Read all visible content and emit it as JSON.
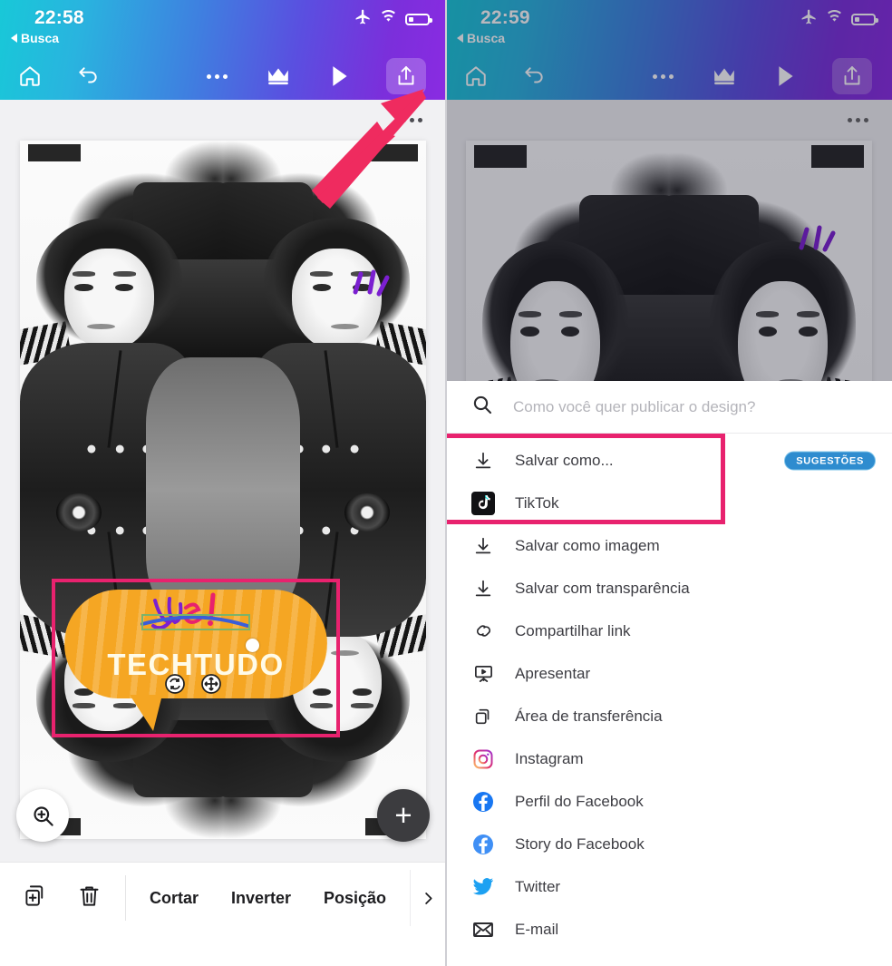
{
  "colors": {
    "accent_pink": "#e8226e",
    "badge_blue": "#2e8ccf",
    "sticker_yellow": "#f5a623",
    "gradient_start": "#18c8d8",
    "gradient_end": "#8a2be2",
    "fab_dark": "#3c3c3f"
  },
  "left_panel": {
    "status": {
      "time": "22:58",
      "back_label": "Busca",
      "icons": [
        "airplane-mode-icon",
        "wifi-icon",
        "battery-icon"
      ]
    },
    "toolbar": {
      "home_icon": "home-icon",
      "undo_icon": "undo-icon",
      "more_icon": "more-dots-icon",
      "crown_icon": "crown-icon",
      "play_icon": "play-icon",
      "share_icon": "share-upload-icon"
    },
    "canvas": {
      "overflow_icon": "more-dots-icon",
      "zoom_icon": "zoom-in-icon",
      "add_label": "+",
      "sticker": {
        "script_text": "yes !",
        "word": "TECHTUDO",
        "rotate_icon": "rotate-handle-icon",
        "move_icon": "move-handle-icon"
      }
    },
    "bottom_toolbar": {
      "duplicate_icon": "duplicate-icon",
      "delete_icon": "trash-icon",
      "items": [
        "Cortar",
        "Inverter",
        "Posição"
      ],
      "more_icon": "chevron-right-icon"
    }
  },
  "right_panel": {
    "status": {
      "time": "22:59",
      "back_label": "Busca",
      "icons": [
        "airplane-mode-icon",
        "wifi-icon",
        "battery-icon"
      ]
    },
    "toolbar": {
      "home_icon": "home-icon",
      "undo_icon": "undo-icon",
      "more_icon": "more-dots-icon",
      "crown_icon": "crown-icon",
      "play_icon": "play-icon",
      "share_icon": "share-upload-icon"
    },
    "canvas": {
      "overflow_icon": "more-dots-icon"
    },
    "publish_sheet": {
      "search_placeholder": "Como você quer publicar o design?",
      "search_icon": "search-icon",
      "badge_label": "SUGESTÕES",
      "items": [
        {
          "label": "Salvar como...",
          "icon": "download-icon"
        },
        {
          "label": "TikTok",
          "icon": "tiktok-icon"
        },
        {
          "label": "Salvar como imagem",
          "icon": "download-icon"
        },
        {
          "label": "Salvar com transparência",
          "icon": "download-icon"
        },
        {
          "label": "Compartilhar link",
          "icon": "link-icon"
        },
        {
          "label": "Apresentar",
          "icon": "present-icon"
        },
        {
          "label": "Área de transferência",
          "icon": "clipboard-copy-icon"
        },
        {
          "label": "Instagram",
          "icon": "instagram-icon"
        },
        {
          "label": "Perfil do Facebook",
          "icon": "facebook-icon"
        },
        {
          "label": "Story do Facebook",
          "icon": "facebook-icon"
        },
        {
          "label": "Twitter",
          "icon": "twitter-icon"
        },
        {
          "label": "E-mail",
          "icon": "email-icon"
        }
      ]
    }
  },
  "annotations": {
    "arrow": "red-arrow-pointing-to-share-button",
    "left_highlight": "pink-box-around-sticker",
    "right_highlight": "pink-box-around-first-two-menu-items"
  }
}
